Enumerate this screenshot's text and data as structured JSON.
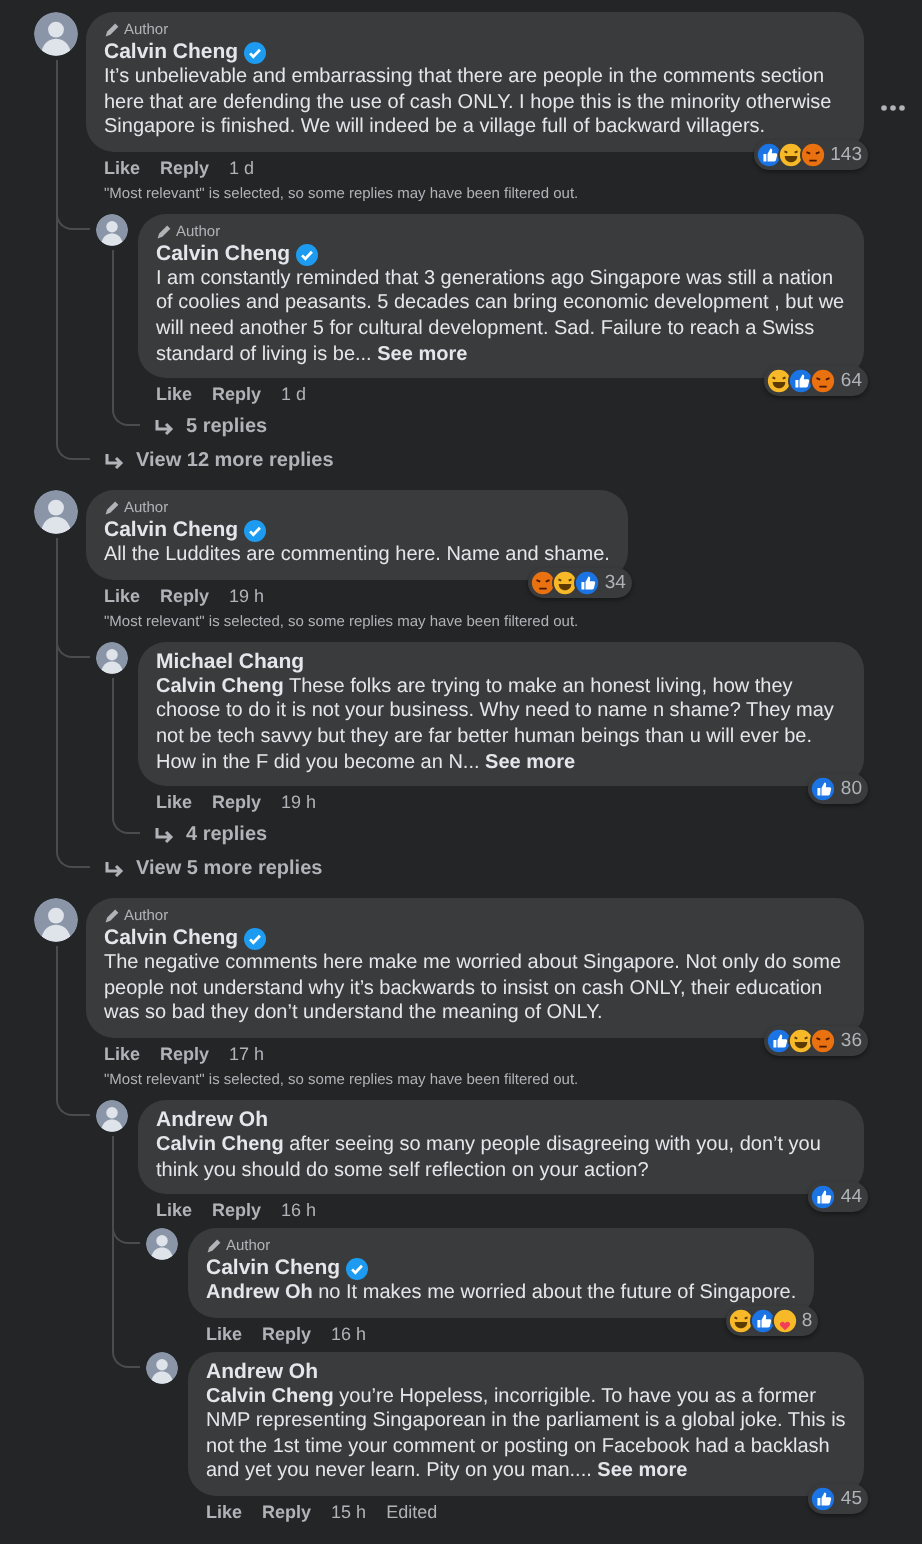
{
  "comments": [
    {
      "badge": "Author",
      "author": "Calvin Cheng",
      "verified": true,
      "menu": true,
      "text": "It’s unbelievable and embarrassing that there are people in the comments section here that are defending the use of cash ONLY. I hope this is the minority otherwise Singapore is finished. We will indeed be a village full of backward villagers.",
      "reactions": [
        {
          "kind": "like"
        },
        {
          "kind": "haha"
        },
        {
          "kind": "angry"
        }
      ],
      "reaction_count": "143",
      "actions": [
        "Like",
        "Reply"
      ],
      "time": "1 d",
      "note": "\"Most relevant\" is selected, so some replies may have been filtered out.",
      "replies": [
        {
          "badge": "Author",
          "author": "Calvin Cheng",
          "verified": true,
          "text": "I am constantly reminded that 3 generations ago Singapore was still a nation of coolies and peasants. 5 decades can bring economic development , but we will need another 5 for cultural development. Sad. Failure to reach a Swiss standard of living is be...",
          "see_more": "See more",
          "reactions": [
            {
              "kind": "haha"
            },
            {
              "kind": "like"
            },
            {
              "kind": "angry"
            }
          ],
          "reaction_count": "64",
          "actions": [
            "Like",
            "Reply"
          ],
          "time": "1 d",
          "replies_link": "5 replies"
        }
      ],
      "replies_link": "View 12 more replies"
    },
    {
      "badge": "Author",
      "author": "Calvin Cheng",
      "verified": true,
      "menu": false,
      "text": "All the Luddites are commenting here. Name and shame.",
      "reactions": [
        {
          "kind": "angry"
        },
        {
          "kind": "haha"
        },
        {
          "kind": "like"
        }
      ],
      "reaction_count": "34",
      "actions": [
        "Like",
        "Reply"
      ],
      "time": "19 h",
      "note": "\"Most relevant\" is selected, so some replies may have been filtered out.",
      "replies": [
        {
          "author": "Michael Chang",
          "verified": false,
          "text": "**Calvin Cheng** These folks are trying to make an honest living, how they choose to do it is not your business. Why need to name n shame? They may not be tech savvy but they are far better human beings than u will ever be. How in the F did you become an N...",
          "see_more": "See more",
          "reactions": [
            {
              "kind": "like"
            }
          ],
          "reaction_count": "80",
          "actions": [
            "Like",
            "Reply"
          ],
          "time": "19 h",
          "replies_link": "4 replies"
        }
      ],
      "replies_link": "View 5 more replies"
    },
    {
      "badge": "Author",
      "author": "Calvin Cheng",
      "verified": true,
      "menu": false,
      "text": "The negative comments here make me worried about Singapore. Not only do some people not understand why it’s backwards to insist on cash ONLY, their education was so bad they don’t understand the meaning of ONLY.",
      "reactions": [
        {
          "kind": "like"
        },
        {
          "kind": "haha"
        },
        {
          "kind": "angry"
        }
      ],
      "reaction_count": "36",
      "actions": [
        "Like",
        "Reply"
      ],
      "time": "17 h",
      "note": "\"Most relevant\" is selected, so some replies may have been filtered out.",
      "replies": [
        {
          "author": "Andrew Oh",
          "verified": false,
          "text": "**Calvin Cheng** after seeing so many people disagreeing with you, don’t you think you should do some self reflection on your action?",
          "reactions": [
            {
              "kind": "like"
            }
          ],
          "reaction_count": "44",
          "actions": [
            "Like",
            "Reply"
          ],
          "time": "16 h",
          "replies": [
            {
              "badge": "Author",
              "author": "Calvin Cheng",
              "verified": true,
              "text": "**Andrew Oh** no It makes me worried about the future of Singapore.",
              "reactions": [
                {
                  "kind": "haha"
                },
                {
                  "kind": "like"
                },
                {
                  "kind": "care"
                }
              ],
              "reaction_count": "8",
              "actions": [
                "Like",
                "Reply"
              ],
              "time": "16 h"
            },
            {
              "author": "Andrew Oh",
              "verified": false,
              "text": "**Calvin Cheng** you’re Hopeless, incorrigible. To have you as a former NMP representing Singaporean in the parliament is a global joke. This is not the 1st time your comment or posting on Facebook had a backlash and yet you never learn. Pity on you man....",
              "see_more": "See more",
              "reactions": [
                {
                  "kind": "like"
                }
              ],
              "reaction_count": "45",
              "actions": [
                "Like",
                "Reply"
              ],
              "time": "15 h",
              "edited": "Edited"
            }
          ]
        }
      ]
    }
  ]
}
